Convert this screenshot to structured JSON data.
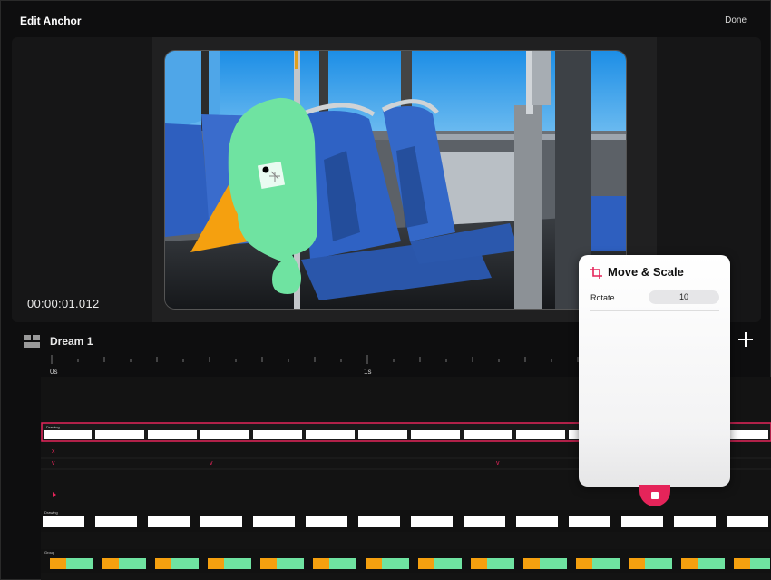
{
  "header": {
    "title": "Edit Anchor",
    "done_label": "Done"
  },
  "canvas": {
    "timestamp": "00:00:01.012"
  },
  "timeline": {
    "name": "Dream 1",
    "ruler_labels": [
      "0s",
      "1s"
    ],
    "track_labels": [
      "Drawing",
      "Drawing",
      "Group"
    ]
  },
  "panel": {
    "title": "Move & Scale",
    "rotate_label": "Rotate",
    "rotate_value": "10"
  },
  "colors": {
    "accent": "#e5245a",
    "bird_green": "#6fe3a1",
    "bird_orange": "#f5a00f",
    "seat_blue": "#2e5fbf"
  }
}
